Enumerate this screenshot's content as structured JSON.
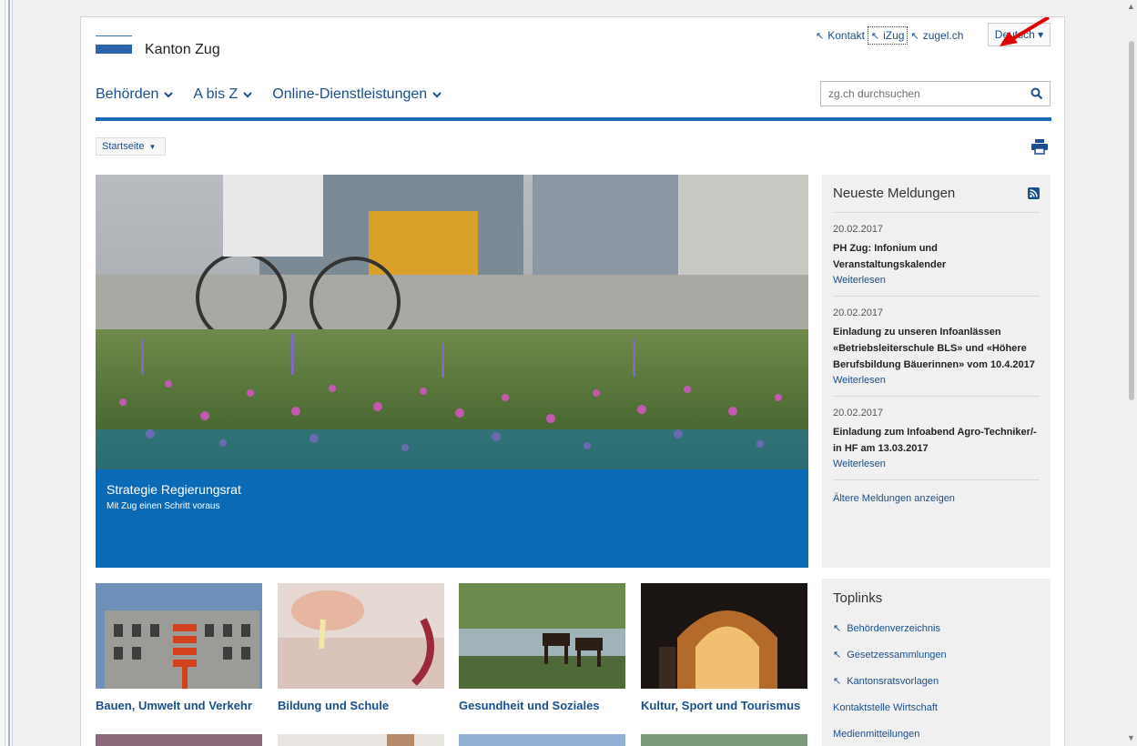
{
  "header": {
    "site_name": "Kanton Zug",
    "top_links": [
      {
        "label": "Kontakt"
      },
      {
        "label": "iZug"
      },
      {
        "label": "zugel.ch"
      }
    ],
    "language": "Deutsch ▾",
    "search_placeholder": "zg.ch durchsuchen"
  },
  "nav": {
    "items": [
      "Behörden",
      "A bis Z",
      "Online-Dienstleistungen"
    ]
  },
  "breadcrumb": {
    "label": "Startseite"
  },
  "hero": {
    "title": "Strategie Regierungsrat",
    "subtitle": "Mit Zug einen Schritt voraus"
  },
  "news": {
    "heading": "Neueste Meldungen",
    "items": [
      {
        "date": "20.02.2017",
        "title": "PH Zug: Infonium und Veranstaltungskalender",
        "more": "Weiterlesen"
      },
      {
        "date": "20.02.2017",
        "title": "Einladung zu unseren Infoanlässen «Betriebsleiterschule BLS» und «Höhere Berufsbildung Bäuerinnen» vom 10.4.2017",
        "more": "Weiterlesen"
      },
      {
        "date": "20.02.2017",
        "title": "Einladung zum Infoabend Agro-Techniker/-in HF am 13.03.2017",
        "more": "Weiterlesen"
      }
    ],
    "older": "Ältere Meldungen anzeigen"
  },
  "tiles": [
    {
      "label": "Bauen, Umwelt und Verkehr"
    },
    {
      "label": "Bildung und Schule"
    },
    {
      "label": "Gesundheit und Soziales"
    },
    {
      "label": "Kultur, Sport und Tourismus"
    }
  ],
  "toplinks": {
    "heading": "Toplinks",
    "items": [
      {
        "label": "Behördenverzeichnis",
        "external": true
      },
      {
        "label": "Gesetzessammlungen",
        "external": true
      },
      {
        "label": "Kantonsratsvorlagen",
        "external": true
      },
      {
        "label": "Kontaktstelle Wirtschaft",
        "external": false
      },
      {
        "label": "Medienmitteilungen",
        "external": false
      }
    ]
  },
  "colors": {
    "brand_blue": "#1a6cb7",
    "link_blue": "#1a4f8b",
    "hero_blue": "#0b6ab5",
    "annotation_red": "#e00000"
  }
}
